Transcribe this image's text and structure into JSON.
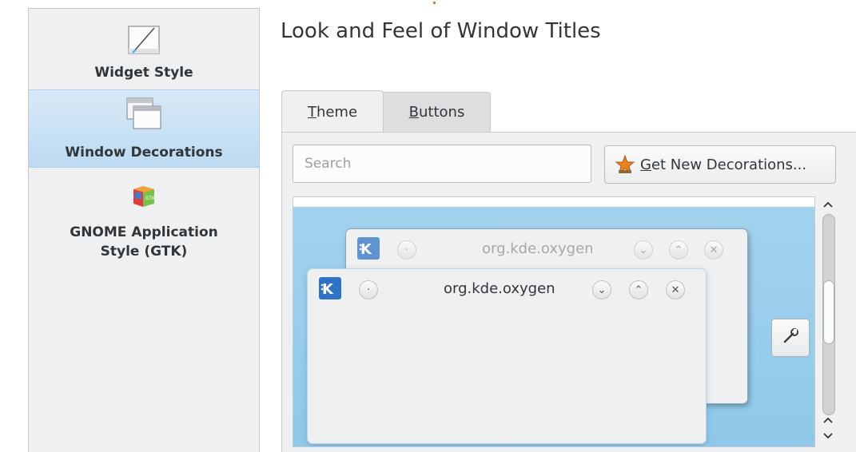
{
  "sidebar": {
    "items": [
      {
        "label": "Widget Style",
        "icon": "widget-style-icon",
        "selected": false
      },
      {
        "label": "Window Decorations",
        "icon": "window-decorations-icon",
        "selected": true
      },
      {
        "label": "GNOME Application\nStyle (GTK)",
        "icon": "gtk-icon",
        "selected": false
      }
    ]
  },
  "main": {
    "title": "Look and Feel of Window Titles",
    "tabs": [
      {
        "label_prefix": "",
        "accel": "T",
        "label_rest": "heme",
        "active": true
      },
      {
        "label_prefix": "",
        "accel": "B",
        "label_rest": "uttons",
        "active": false
      }
    ],
    "search": {
      "placeholder": "Search",
      "value": ""
    },
    "get_new_button": {
      "accel": "G",
      "label_rest": "et New Decorations...",
      "icon": "star-icon"
    },
    "preview": {
      "back_window_title": "org.kde.oxygen",
      "front_window_title": "org.kde.oxygen",
      "configure_icon": "wrench-icon"
    }
  },
  "colors": {
    "selection": "#a2d3ee",
    "sidebar_bg": "#eff0f1",
    "sidebar_selected": "#c9e1f5",
    "text": "#31363b",
    "accent_star": "#e8821e"
  }
}
